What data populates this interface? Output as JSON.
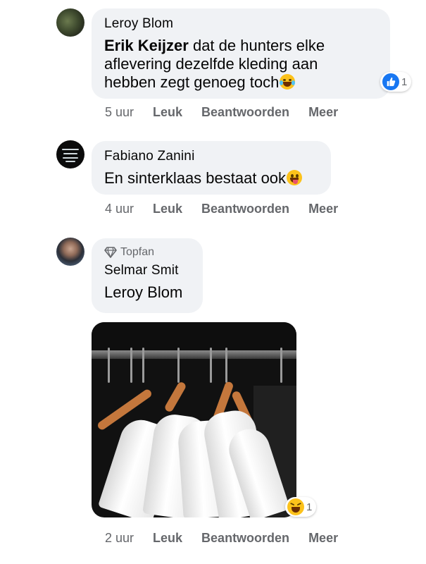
{
  "comments": [
    {
      "author": "Leroy Blom",
      "mention": "Erik Keijzer",
      "text": " dat de hunters elke aflevering dezelfde kleding aan hebben zegt genoeg toch",
      "emoji": "tears-of-joy-emoji",
      "reaction_count": "1",
      "time": "5 uur"
    },
    {
      "author": "Fabiano Zanini",
      "text": "En sinterklaas bestaat ook",
      "emoji": "tongue-out-emoji",
      "time": "4 uur"
    },
    {
      "badge": "Topfan",
      "author": "Selmar Smit",
      "mention": "Leroy Blom",
      "photo": "white-shirts-on-hangers",
      "reaction_count": "1",
      "time": "2 uur"
    }
  ],
  "actions": {
    "like": "Leuk",
    "reply": "Beantwoorden",
    "more": "Meer"
  }
}
